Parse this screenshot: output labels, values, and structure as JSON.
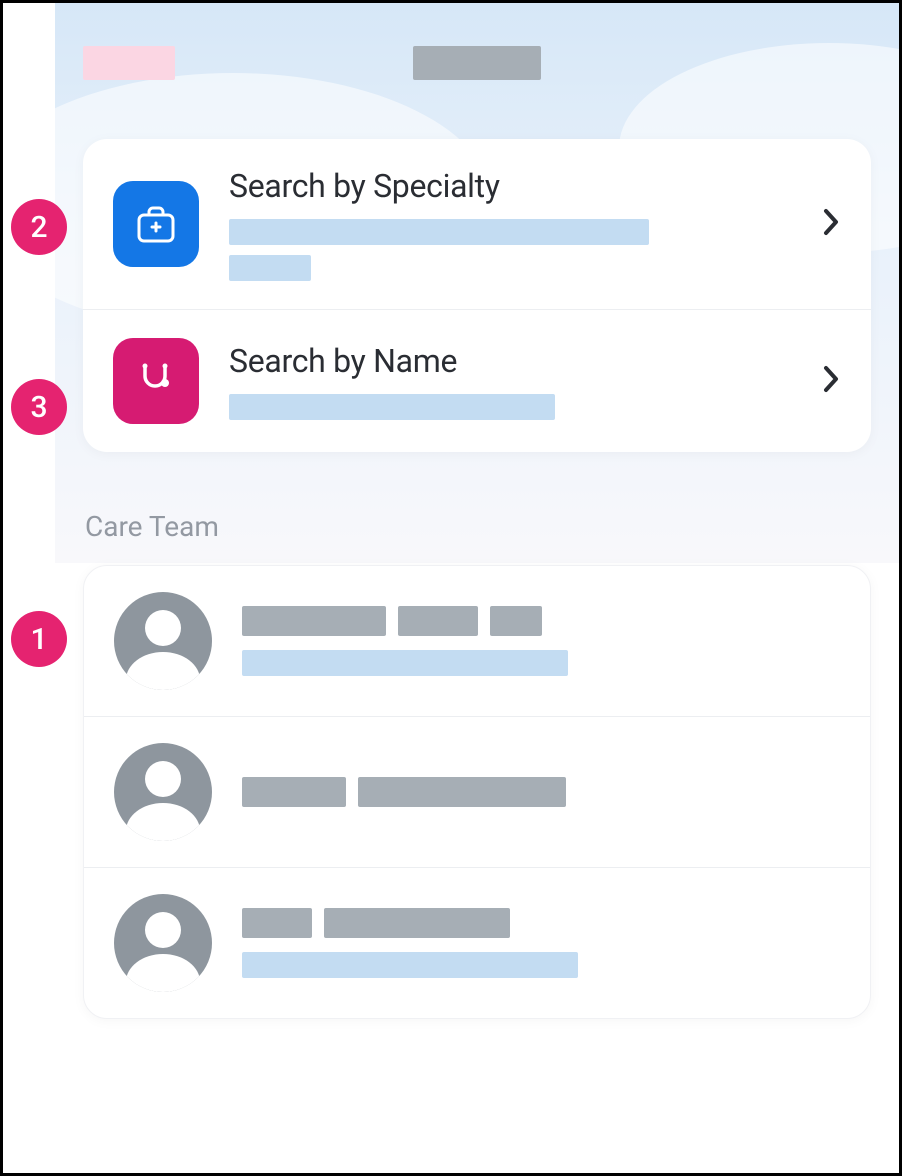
{
  "header": {
    "back_label": "",
    "title": ""
  },
  "search_options": [
    {
      "icon": "medical-bag-icon",
      "icon_color": "#1477e6",
      "title": "Search by Specialty",
      "subtitle_lines": [
        "",
        ""
      ]
    },
    {
      "icon": "stethoscope-icon",
      "icon_color": "#d61b72",
      "title": "Search by Name",
      "subtitle_lines": [
        ""
      ]
    }
  ],
  "care_team": {
    "section_label": "Care Team",
    "members": [
      {
        "name_parts": [
          "",
          "",
          ""
        ],
        "subtitle": ""
      },
      {
        "name_parts": [
          "",
          ""
        ],
        "subtitle": null
      },
      {
        "name_parts": [
          "",
          ""
        ],
        "subtitle": ""
      }
    ]
  },
  "markers": {
    "one": "1",
    "two": "2",
    "three": "3"
  }
}
